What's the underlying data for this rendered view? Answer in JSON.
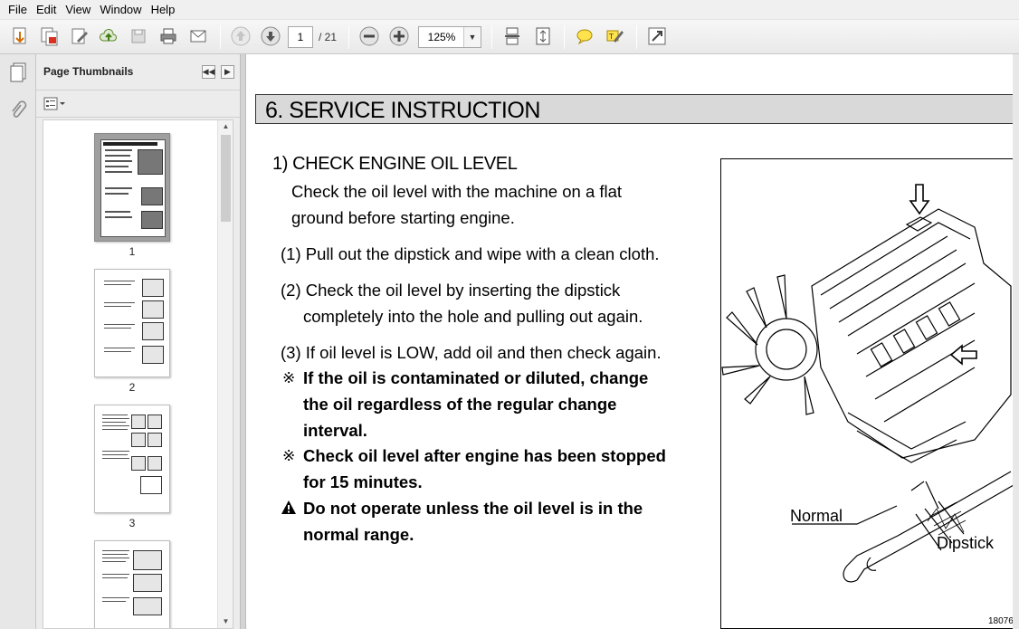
{
  "menu": [
    "File",
    "Edit",
    "View",
    "Window",
    "Help"
  ],
  "toolbar": {
    "current_page": "1",
    "total_pages": "/ 21",
    "zoom": "125%"
  },
  "thumbnails": {
    "title": "Page Thumbnails",
    "pages": [
      "1",
      "2",
      "3"
    ]
  },
  "document": {
    "section_title": "6. SERVICE INSTRUCTION",
    "heading": "1) CHECK ENGINE OIL LEVEL",
    "intro_line1": "Check the oil level with the machine on a flat",
    "intro_line2": "ground before starting engine.",
    "step1": "(1) Pull out the dipstick and wipe with a clean cloth.",
    "step2_line1": "(2) Check the oil level by inserting the dipstick",
    "step2_line2": "completely into the hole and pulling out again.",
    "step3": "(3) If oil level is LOW, add oil and then check again.",
    "note1_line1": "If the oil is contaminated or diluted, change",
    "note1_line2": "the oil regardless of the regular change",
    "note1_line3": "interval.",
    "note2_line1": "Check oil level after engine has been stopped",
    "note2_line2": "for 15 minutes.",
    "warn_line1": "Do not operate unless the oil level is in the",
    "warn_line2": "normal range.",
    "note_mark": "※",
    "figure": {
      "label_normal": "Normal",
      "label_dipstick": "Dipstick",
      "fig_number": "18076"
    }
  }
}
